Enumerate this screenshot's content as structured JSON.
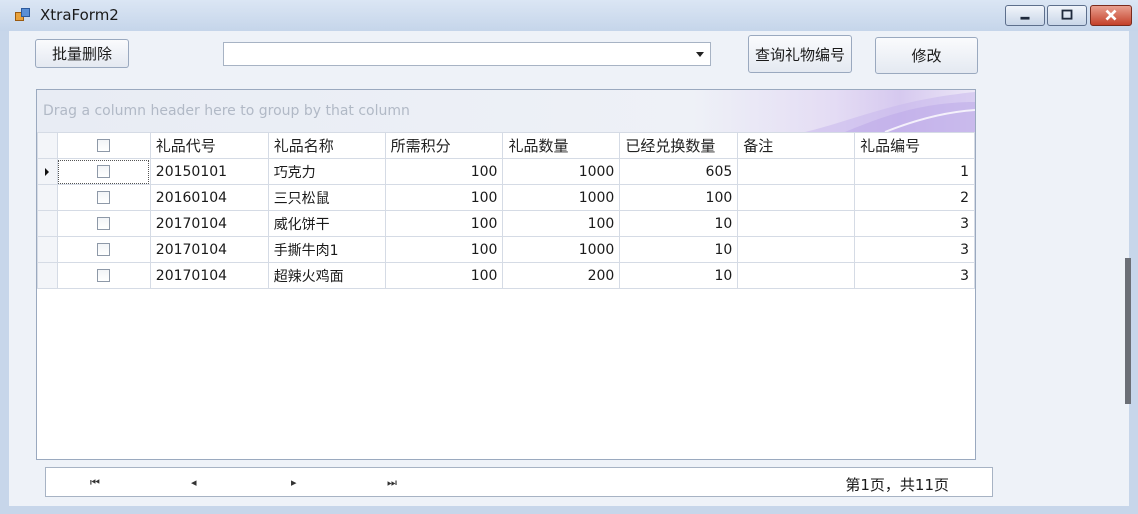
{
  "window": {
    "title": "XtraForm2"
  },
  "toolbar": {
    "batch_delete_label": "批量删除",
    "combo_value": "",
    "query_gift_no_label": "查询礼物编号",
    "modify_label": "修改"
  },
  "grid": {
    "group_panel_text": "Drag a column header here to group by that column",
    "columns": [
      "礼品代号",
      "礼品名称",
      "所需积分",
      "礼品数量",
      "已经兑换数量",
      "备注",
      "礼品编号"
    ],
    "rows": [
      {
        "code": "20150101",
        "name": "巧克力",
        "points": "100",
        "qty": "1000",
        "redeemed": "605",
        "note": "",
        "no": "1"
      },
      {
        "code": "20160104",
        "name": "三只松鼠",
        "points": "100",
        "qty": "1000",
        "redeemed": "100",
        "note": "",
        "no": "2"
      },
      {
        "code": "20170104",
        "name": "威化饼干",
        "points": "100",
        "qty": "100",
        "redeemed": "10",
        "note": "",
        "no": "3"
      },
      {
        "code": "20170104",
        "name": "手撕牛肉1",
        "points": "100",
        "qty": "1000",
        "redeemed": "10",
        "note": "",
        "no": "3"
      },
      {
        "code": "20170104",
        "name": "超辣火鸡面",
        "points": "100",
        "qty": "200",
        "redeemed": "10",
        "note": "",
        "no": "3"
      }
    ]
  },
  "pager": {
    "first_glyph": "⏮",
    "prev_glyph": "◂",
    "next_glyph": "▸",
    "last_glyph": "⏭",
    "page_info": "第1页，共11页"
  }
}
